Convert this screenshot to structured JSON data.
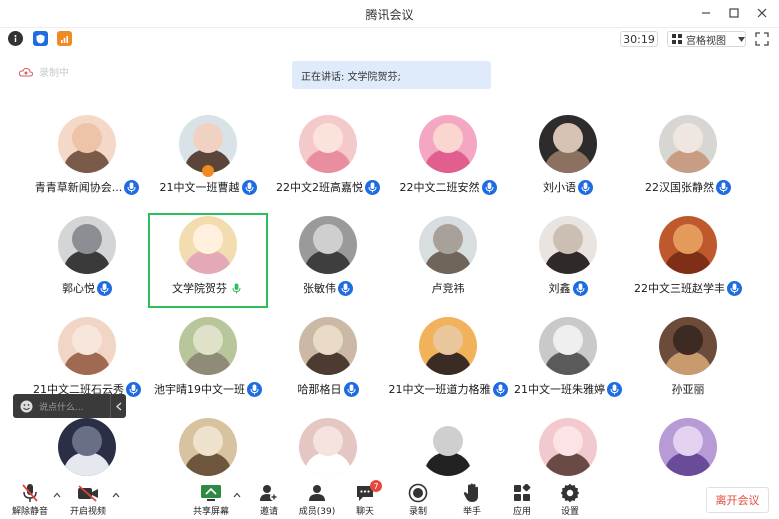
{
  "window": {
    "title": "腾讯会议"
  },
  "toolbar": {
    "timer": "30:19",
    "view_label": "宫格视图"
  },
  "recording_label": "录制中",
  "speaking_text": "正在讲话: 文学院贺芬;",
  "participants": [
    {
      "name": "青青草新闻协会...",
      "mic": "blue",
      "host": false,
      "colors": [
        "#f5d9c8",
        "#7a5a48",
        "#efc3a8"
      ]
    },
    {
      "name": "21中文一班曹越",
      "mic": "blue",
      "host": true,
      "colors": [
        "#d9e2e6",
        "#5b4438",
        "#f0d2c2"
      ]
    },
    {
      "name": "22中文2班高嘉悦",
      "mic": "blue",
      "host": false,
      "colors": [
        "#f4c9c9",
        "#e88e9e",
        "#fbe3dc"
      ]
    },
    {
      "name": "22中文二班安然",
      "mic": "blue",
      "host": false,
      "colors": [
        "#f3a7c3",
        "#e05f8e",
        "#fbd5cf"
      ]
    },
    {
      "name": "刘小语",
      "mic": "blue",
      "host": false,
      "colors": [
        "#2e2b2b",
        "#8c7060",
        "#d6c3b4"
      ]
    },
    {
      "name": "22汉国张静然",
      "mic": "blue",
      "host": false,
      "colors": [
        "#d8d6d2",
        "#c79e83",
        "#efe7df"
      ]
    },
    {
      "name": "郭心悦",
      "mic": "blue",
      "host": false,
      "colors": [
        "#d3d5d7",
        "#3a3a3a",
        "#8b8f94"
      ]
    },
    {
      "name": "文学院贺芬",
      "mic": "green",
      "host": false,
      "colors": [
        "#f3dcb0",
        "#e3a9b6",
        "#fff1dd"
      ]
    },
    {
      "name": "张敏伟",
      "mic": "blue",
      "host": false,
      "colors": [
        "#9a9a9a",
        "#3e3e3e",
        "#cfcfcf"
      ]
    },
    {
      "name": "卢竞祎",
      "mic": "none",
      "host": false,
      "colors": [
        "#d8dde0",
        "#6f655b",
        "#a8a199"
      ]
    },
    {
      "name": "刘鑫",
      "mic": "blue",
      "host": false,
      "colors": [
        "#e9e4df",
        "#2f2a28",
        "#cbbfb4"
      ]
    },
    {
      "name": "22中文三班赵学丰",
      "mic": "blue",
      "host": false,
      "colors": [
        "#c0582d",
        "#7e2f15",
        "#e49a5a"
      ]
    },
    {
      "name": "21中文二班石云秀",
      "mic": "blue",
      "host": false,
      "colors": [
        "#f1d6c6",
        "#a06a52",
        "#f7e6db"
      ]
    },
    {
      "name": "池宇晴19中文一班",
      "mic": "blue",
      "host": false,
      "colors": [
        "#b9c59a",
        "#8f8b78",
        "#dfe2c9"
      ]
    },
    {
      "name": "哈那格日",
      "mic": "blue",
      "host": false,
      "colors": [
        "#cbb9a6",
        "#4d3a30",
        "#eadbc9"
      ]
    },
    {
      "name": "21中文一班道力格雅",
      "mic": "blue",
      "host": false,
      "colors": [
        "#f2b15b",
        "#3a2c22",
        "#e9c79a"
      ]
    },
    {
      "name": "21中文一班朱雅婷",
      "mic": "blue",
      "host": false,
      "colors": [
        "#c9c9c9",
        "#5a5a5a",
        "#efefef"
      ]
    },
    {
      "name": "孙亚丽",
      "mic": "none",
      "host": false,
      "colors": [
        "#6d4b3a",
        "#c89a6e",
        "#3d2a22"
      ]
    },
    {
      "name": "",
      "mic": "none",
      "host": false,
      "colors": [
        "#2a2f45",
        "#e6e8f0",
        "#6a6f88"
      ]
    },
    {
      "name": "",
      "mic": "none",
      "host": false,
      "colors": [
        "#d8c3a1",
        "#6e553e",
        "#efe2cd"
      ]
    },
    {
      "name": "",
      "mic": "none",
      "host": false,
      "colors": [
        "#e4c7c2",
        "#ffffff",
        "#f4e3df"
      ]
    },
    {
      "name": "",
      "mic": "none",
      "host": false,
      "colors": [
        "#ffffff",
        "#222222",
        "#cfcfcf"
      ]
    },
    {
      "name": "",
      "mic": "none",
      "host": false,
      "colors": [
        "#f2c9cf",
        "#6a4a44",
        "#fbe3e6"
      ]
    },
    {
      "name": "",
      "mic": "none",
      "host": false,
      "colors": [
        "#b79ad6",
        "#6a4b9a",
        "#e3d3f1"
      ]
    }
  ],
  "chat_bubble": {
    "placeholder": "说点什么..."
  },
  "bottom_bar": {
    "unmute": "解除静音",
    "start_video": "开启视频",
    "share_screen": "共享屏幕",
    "invite": "邀请",
    "members": "成员(39)",
    "chat": "聊天",
    "chat_badge": "7",
    "record": "录制",
    "raise_hand": "举手",
    "apps": "应用",
    "settings": "设置",
    "leave": "离开会议"
  },
  "colors": {
    "accent": "#1f6be0",
    "active_border": "#2fbf5a",
    "leave": "#e04a3f",
    "speaking_bg": "#dfeafb"
  }
}
